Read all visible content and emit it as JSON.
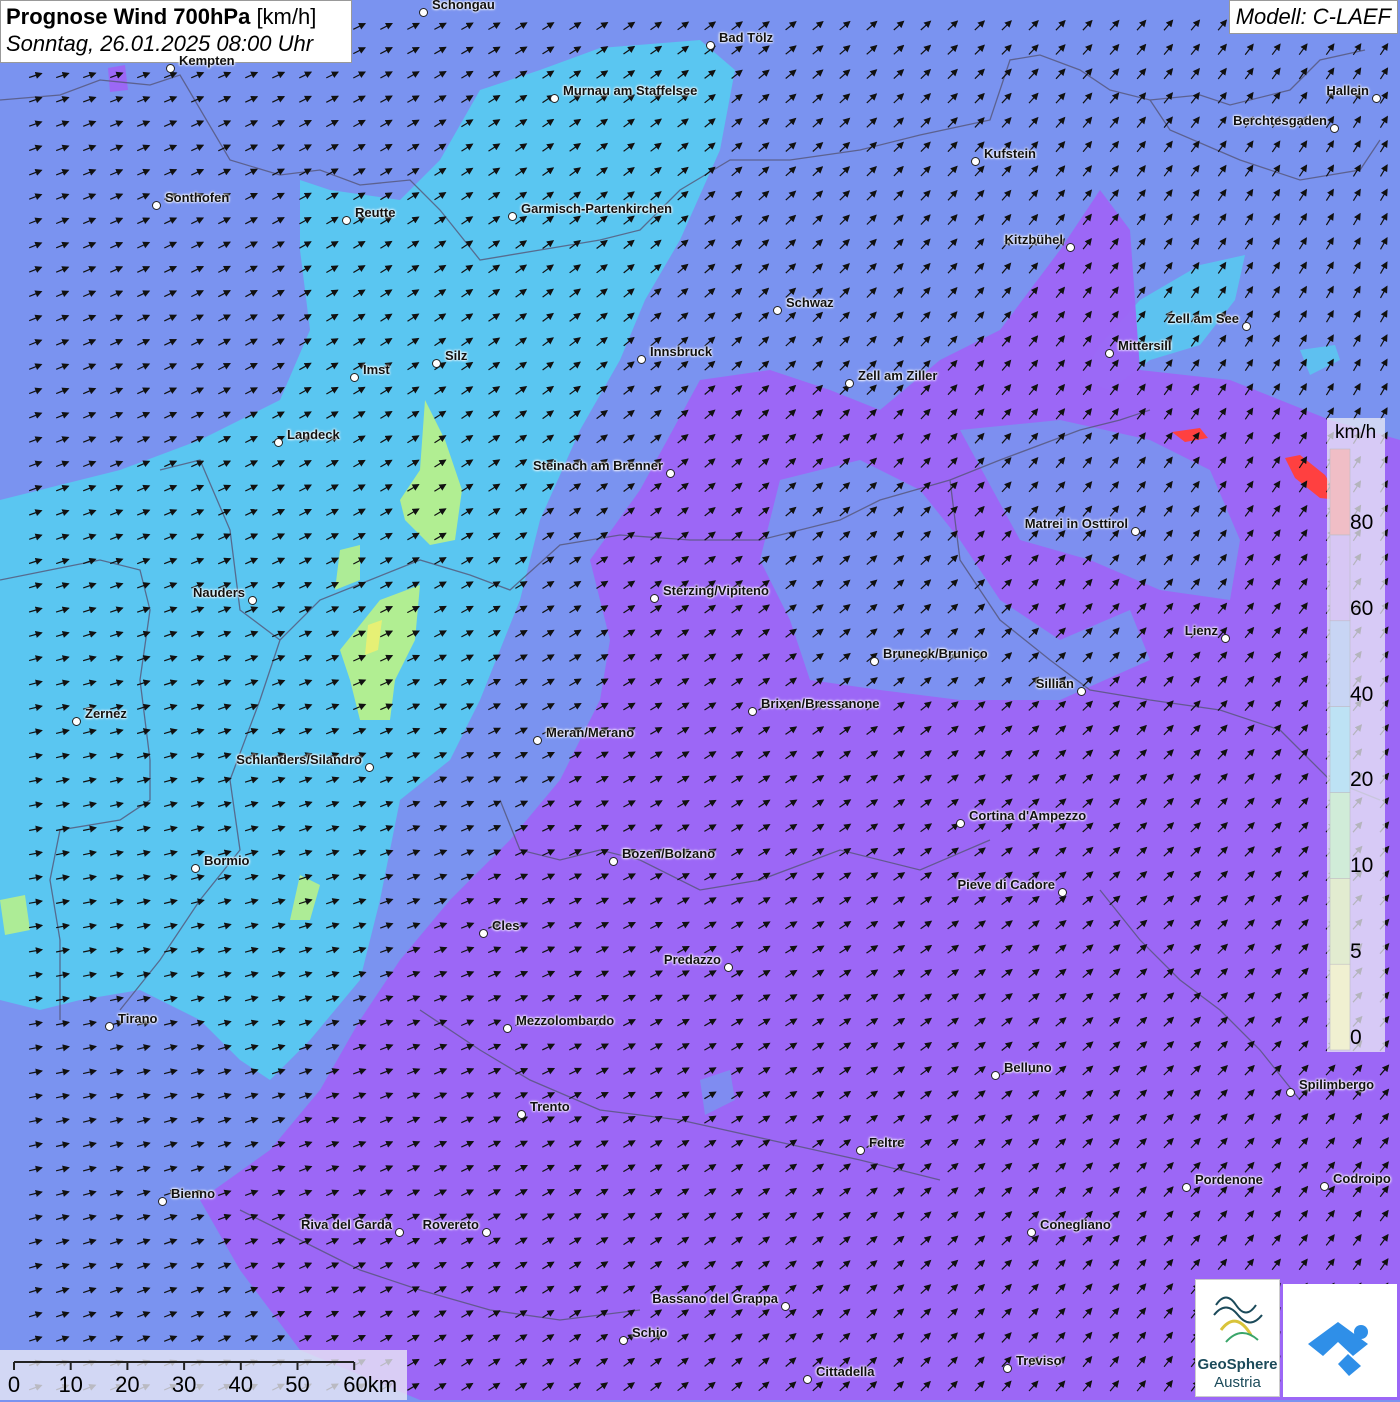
{
  "header": {
    "title_bold": "Prognose Wind 700hPa",
    "title_unit": "[km/h]",
    "datetime": "Sonntag, 26.01.2025 08:00 Uhr",
    "model": "Modell: C-LAEF"
  },
  "legend": {
    "unit": "km/h",
    "ticks": [
      "0",
      "5",
      "10",
      "20",
      "40",
      "60",
      "80"
    ],
    "colors": [
      "#ffff66",
      "#c8f060",
      "#80f080",
      "#34c8f0",
      "#5f94ef",
      "#9a5cf0",
      "#ff3b3b"
    ]
  },
  "colors": {
    "background": "#7a93f0",
    "cyan_zone": "#59c8f0",
    "violet_zone": "#9e64f5",
    "green_zone": "#b6f08c",
    "blue_zone": "#6d8ef0",
    "red_cell": "#ff4040",
    "border": "#555577",
    "arrow": "#111111"
  },
  "scale": {
    "labels": [
      "0",
      "10",
      "20",
      "30",
      "40",
      "50",
      "60km"
    ]
  },
  "logos": {
    "geosphere_line1": "GeoSphere",
    "geosphere_line2": "Austria"
  },
  "cities": [
    {
      "name": "Schongau"
    },
    {
      "name": "Kempten"
    },
    {
      "name": "Bad Tölz"
    },
    {
      "name": "Murnau am Staffelsee"
    },
    {
      "name": "Hallein"
    },
    {
      "name": "Berchtesgaden"
    },
    {
      "name": "Kufstein"
    },
    {
      "name": "Sonthofen"
    },
    {
      "name": "Reutte"
    },
    {
      "name": "Garmisch-Partenkirchen"
    },
    {
      "name": "Kitzbühel"
    },
    {
      "name": "Schwaz"
    },
    {
      "name": "Zell am See"
    },
    {
      "name": "Mittersill"
    },
    {
      "name": "Innsbruck"
    },
    {
      "name": "Imst"
    },
    {
      "name": "Silz"
    },
    {
      "name": "Zell am Ziller"
    },
    {
      "name": "Landeck"
    },
    {
      "name": "Steinach am Brenner"
    },
    {
      "name": "Matrei in Osttirol"
    },
    {
      "name": "Nauders"
    },
    {
      "name": "Sterzing/Vipiteno"
    },
    {
      "name": "Lienz"
    },
    {
      "name": "Bruneck/Brunico"
    },
    {
      "name": "Sillian"
    },
    {
      "name": "Zernez"
    },
    {
      "name": "Brixen/Bressanone"
    },
    {
      "name": "Meran/Merano"
    },
    {
      "name": "Schlanders/Silandro"
    },
    {
      "name": "Cortina d'Ampezzo"
    },
    {
      "name": "Bozen/Bolzano"
    },
    {
      "name": "Bormio"
    },
    {
      "name": "Pieve di Cadore"
    },
    {
      "name": "Cles"
    },
    {
      "name": "Predazzo"
    },
    {
      "name": "Tirano"
    },
    {
      "name": "Mezzolombardo"
    },
    {
      "name": "Belluno"
    },
    {
      "name": "Spilimbergo"
    },
    {
      "name": "Trento"
    },
    {
      "name": "Feltre"
    },
    {
      "name": "Pordenone"
    },
    {
      "name": "Codroipo"
    },
    {
      "name": "Bienno"
    },
    {
      "name": "Riva del Garda"
    },
    {
      "name": "Rovereto"
    },
    {
      "name": "Conegliano"
    },
    {
      "name": "Bassano del Grappa"
    },
    {
      "name": "Schio"
    },
    {
      "name": "Treviso"
    },
    {
      "name": "Cittadella"
    }
  ]
}
